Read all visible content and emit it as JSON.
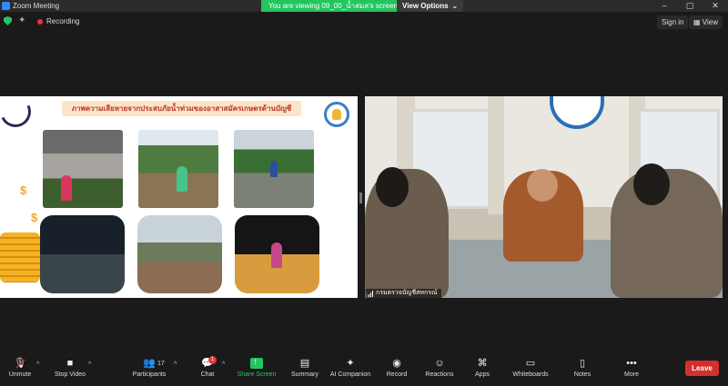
{
  "window": {
    "title": "Zoom Meeting",
    "banner": "You are viewing 09_00_น้ำสมล's screen",
    "view_options": "View Options",
    "controls": [
      "–",
      "▢",
      "✕"
    ]
  },
  "topbar": {
    "recording_label": "Recording",
    "sign_in": "Sign in",
    "view": "View"
  },
  "shared_slide": {
    "title": "ภาพความเสียหายจากประสบภัยน้ำท่วมของอาสาสมัครเกษตรด้านบัญชี",
    "photos": 6
  },
  "video": {
    "participant_name": "กรมตรวจบัญชีสหกรณ์",
    "seal_text": "กรมตรวจบัญชีสหกรณ์"
  },
  "toolbar": {
    "items": [
      {
        "label": "Unmute",
        "icon": "microphone-muted-icon"
      },
      {
        "label": "Stop Video",
        "icon": "video-camera-icon"
      },
      {
        "label": "Participants",
        "icon": "participants-icon"
      },
      {
        "label": "Chat",
        "icon": "chat-icon"
      },
      {
        "label": "Share Screen",
        "icon": "share-screen-icon"
      },
      {
        "label": "Summary",
        "icon": "summary-icon"
      },
      {
        "label": "AI Companion",
        "icon": "ai-companion-icon"
      },
      {
        "label": "Record",
        "icon": "record-icon"
      },
      {
        "label": "Reactions",
        "icon": "reactions-icon"
      },
      {
        "label": "Apps",
        "icon": "apps-icon"
      },
      {
        "label": "Whiteboards",
        "icon": "whiteboards-icon"
      },
      {
        "label": "Notes",
        "icon": "notes-icon"
      },
      {
        "label": "More",
        "icon": "more-icon"
      }
    ],
    "participants_count": "17",
    "chat_badge": "1",
    "leave": "Leave"
  },
  "colors": {
    "accent_green": "#23c55e",
    "leave_red": "#d32f2f",
    "recording_red": "#ee3333"
  }
}
